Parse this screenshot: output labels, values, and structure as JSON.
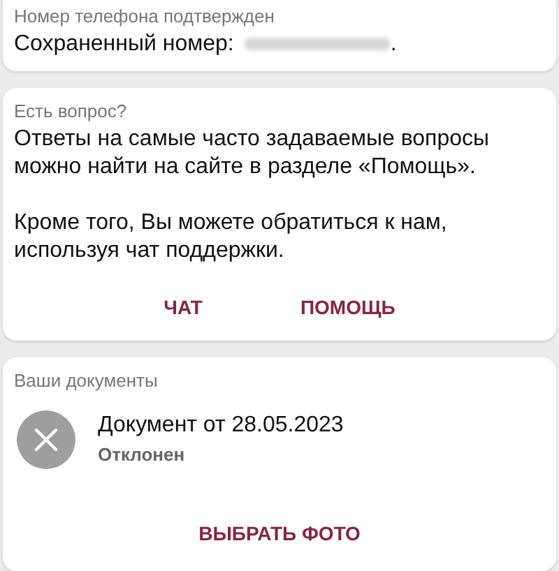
{
  "phone_card": {
    "title": "Номер телефона подтвержден",
    "saved_label": "Сохраненный номер:",
    "saved_suffix": "."
  },
  "help_card": {
    "title": "Есть вопрос?",
    "paragraphs": [
      "Ответы на самые часто задаваемые вопросы можно найти на сайте в разделе «Помощь».",
      "Кроме того, Вы можете обратиться к нам, используя чат поддержки."
    ],
    "buttons": [
      "ЧАТ",
      "ПОМОЩЬ"
    ]
  },
  "documents_card": {
    "title": "Ваши документы",
    "documents": [
      {
        "name": "Документ от 28.05.2023",
        "status": "Отклонен",
        "kind": "rejected"
      }
    ],
    "button": "ВЫБРАТЬ ФОТО"
  }
}
